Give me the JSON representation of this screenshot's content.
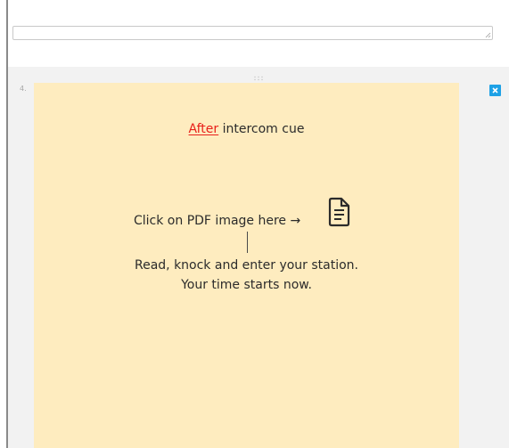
{
  "note": {
    "row_number": "4.",
    "cue_emphasis": "After",
    "cue_rest": " intercom cue",
    "pdf_prompt": "Click on PDF image here →",
    "instruction_line_1": "Read, knock and enter your station.",
    "instruction_line_2": "Your time starts now."
  },
  "icons": {
    "pdf": "pdf-document-icon",
    "delete": "close-icon",
    "drag": "drag-handle-icon",
    "resize": "resize-grip-icon"
  },
  "colors": {
    "note_background": "#feecbf",
    "emphasis_red": "#e8201a",
    "accent_blue": "#1ea1e6",
    "block_background": "#f2f2f2"
  }
}
